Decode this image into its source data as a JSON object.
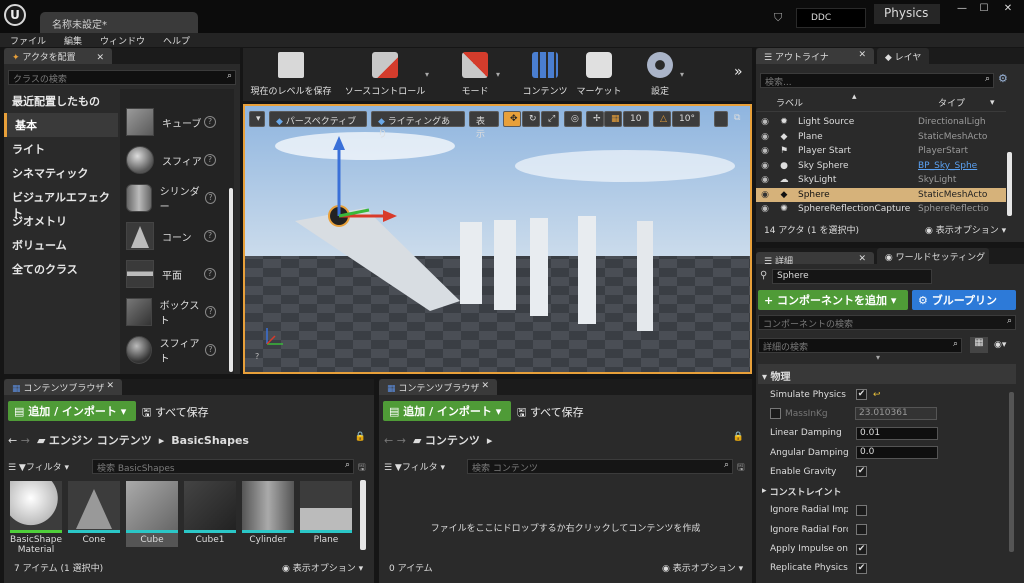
{
  "window": {
    "doc_tab": "名称未設定*",
    "ddc": "DDC",
    "project_tag": "Physics"
  },
  "menu": [
    "ファイル",
    "編集",
    "ウィンドウ",
    "ヘルプ"
  ],
  "place_actors": {
    "tab": "アクタを配置",
    "search_placeholder": "クラスの検索",
    "categories": [
      "最近配置したもの",
      "基本",
      "ライト",
      "シネマティック",
      "ビジュアルエフェクト",
      "ジオメトリ",
      "ボリューム",
      "全てのクラス"
    ],
    "active_category": "基本",
    "shapes": [
      "キューブ",
      "スフィア",
      "シリンダー",
      "コーン",
      "平面",
      "ボックスト",
      "スフィアト"
    ]
  },
  "toolbar": {
    "items": [
      "現在のレベルを保存",
      "ソースコントロール",
      "モード",
      "コンテンツ",
      "マーケット",
      "設定"
    ]
  },
  "viewport": {
    "perspective": "パースペクティブ",
    "lighting": "ライティングあり",
    "show": "表示",
    "snap_grid": "10",
    "snap_rot": "10°"
  },
  "outliner": {
    "tab": "アウトライナ",
    "layer_tab": "レイヤ",
    "search_placeholder": "検索...",
    "col_label": "ラベル",
    "col_type": "タイプ",
    "rows": [
      {
        "name": "Light Source",
        "type": "DirectionalLigh",
        "selected": false
      },
      {
        "name": "Plane",
        "type": "StaticMeshActo",
        "selected": false
      },
      {
        "name": "Player Start",
        "type": "PlayerStart",
        "selected": false
      },
      {
        "name": "Sky Sphere",
        "type": "BP_Sky_Sphe",
        "selected": false,
        "link": true
      },
      {
        "name": "SkyLight",
        "type": "SkyLight",
        "selected": false
      },
      {
        "name": "Sphere",
        "type": "StaticMeshActo",
        "selected": true
      },
      {
        "name": "SphereReflectionCapture",
        "type": "SphereReflectio",
        "selected": false
      }
    ],
    "status": "14 アクタ (1 を選択中)",
    "view_options": "表示オプション"
  },
  "details": {
    "tab": "詳細",
    "world_tab": "ワールドセッティング",
    "actor_name": "Sphere",
    "add_component": "+ コンポーネントを追加",
    "blueprint": "ブループリン",
    "component_search": "コンポーネントの検索",
    "details_search": "詳細の検索",
    "physics_header": "物理",
    "constraints": "コンストレイント",
    "props": [
      {
        "label": "Simulate Physics",
        "kind": "check",
        "value": "✔"
      },
      {
        "label": "MassInKg",
        "kind": "num",
        "value": "23.010361",
        "disabled": true
      },
      {
        "label": "Linear Damping",
        "kind": "num",
        "value": "0.01"
      },
      {
        "label": "Angular Damping",
        "kind": "num",
        "value": "0.0"
      },
      {
        "label": "Enable Gravity",
        "kind": "check",
        "value": "✔"
      },
      {
        "label": "Ignore Radial Impu",
        "kind": "check",
        "value": ""
      },
      {
        "label": "Ignore Radial Force",
        "kind": "check",
        "value": ""
      },
      {
        "label": "Apply Impulse on D",
        "kind": "check",
        "value": "✔"
      },
      {
        "label": "Replicate Physics",
        "kind": "check",
        "value": "✔"
      }
    ]
  },
  "content_left": {
    "tab": "コンテンツブラウザ",
    "add_import": "追加 / インポート",
    "save_all": "すべて保存",
    "path": [
      "エンジン コンテンツ",
      "BasicShapes"
    ],
    "filter": "フィルタ",
    "search_placeholder": "検索 BasicShapes",
    "assets": [
      "BasicShape Material",
      "Cone",
      "Cube",
      "Cube1",
      "Cylinder",
      "Plane"
    ],
    "status": "7 アイテム (1 選択中)",
    "view_options": "表示オプション"
  },
  "content_right": {
    "tab": "コンテンツブラウザ",
    "add_import": "追加 / インポート",
    "save_all": "すべて保存",
    "path": "コンテンツ",
    "filter": "フィルタ",
    "search_placeholder": "検索 コンテンツ",
    "empty_msg": "ファイルをここにドロップするか右クリックしてコンテンツを作成",
    "status": "0 アイテム",
    "view_options": "表示オプション"
  }
}
